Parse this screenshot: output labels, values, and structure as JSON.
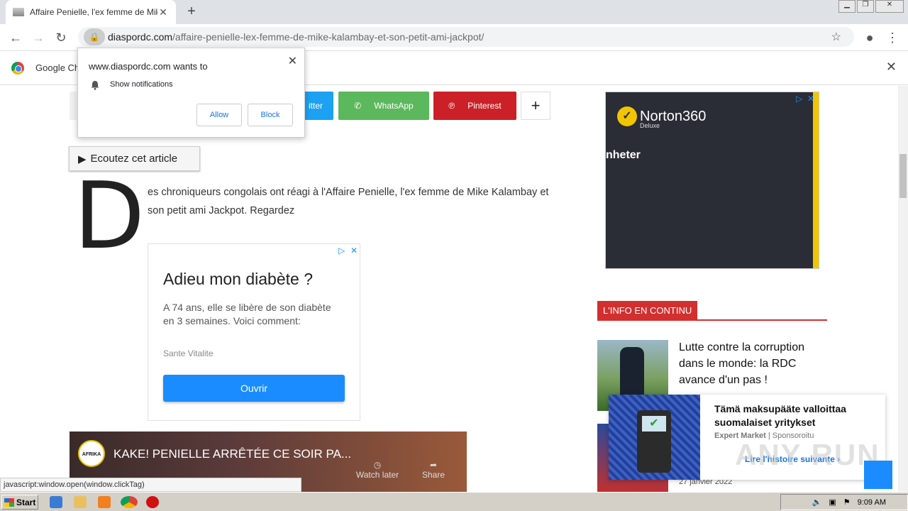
{
  "browser": {
    "tab_title": "Affaire Penielle, l'ex femme de Mike",
    "tab_close": "✕",
    "new_tab": "+",
    "url_host": "diaspordc.com",
    "url_path": "/affaire-penielle-lex-femme-de-mike-kalambay-et-son-petit-ami-jackpot/",
    "infobar_text": "Google Ch"
  },
  "notification": {
    "site": "www.diaspordc.com wants to",
    "permission": "Show notifications",
    "allow": "Allow",
    "block": "Block"
  },
  "share": {
    "twitter": "Twitter",
    "twitter_visible": "itter",
    "whatsapp": "WhatsApp",
    "pinterest": "Pinterest",
    "more": "+"
  },
  "article": {
    "listen": "Ecoutez cet article",
    "dropcap": "D",
    "text": "es chroniqueurs congolais ont réagi à l'Affaire Penielle, l'ex femme de Mike Kalambay et son petit ami Jackpot. Regardez"
  },
  "ad_main": {
    "title": "Adieu mon diabète ?",
    "body": "A 74 ans, elle se libère de son diabète en 3 semaines. Voici comment:",
    "source": "Sante Vitalite",
    "cta": "Ouvrir"
  },
  "video": {
    "title": "KAKE! PENIELLE ARRÊTÉE CE SOIR PA...",
    "logo": "AFRIKA ELENGI TV",
    "watch_later": "Watch later",
    "share": "Share"
  },
  "side_ad": {
    "brand": "Norton360",
    "sub": "Deluxe",
    "text": "nheter"
  },
  "sidebar": {
    "section": "L'INFO EN CONTINU",
    "news_title": "Lutte contre la corruption dans le monde: la RDC avance d'un pas !",
    "news_date": "27 janvier 2022"
  },
  "promo": {
    "title": "Tämä maksupääte valloittaa suomalaiset yritykset",
    "source": "Expert Market",
    "sponsored": "Sponsoroitu",
    "cta": "Lire l'histoire suivante ›"
  },
  "watermark": "ANY RUN",
  "status_text": "javascript:window.open(window.clickTag)",
  "taskbar": {
    "start": "Start",
    "clock": "9:09 AM"
  },
  "colors": {
    "twitter": "#1da1f2",
    "whatsapp": "#5cb85c",
    "pinterest": "#cb2027",
    "accent_red": "#d32f2f"
  }
}
